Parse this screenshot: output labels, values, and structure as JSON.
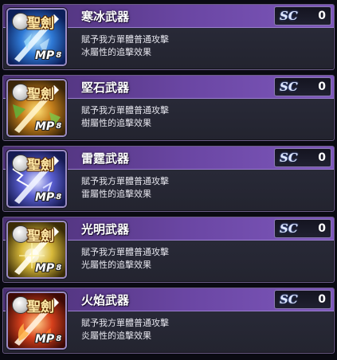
{
  "skills": [
    {
      "name": "寒冰武器",
      "sc_label": "SC",
      "sc_value": "0",
      "desc_line1": "賦予我方單體普通攻擊",
      "desc_line2": "冰屬性的追擊效果",
      "icon": {
        "label": "聖劍",
        "mp_label": "MP",
        "mp_value": "8",
        "element": "ice-sword-icon",
        "bg": "#1b4fb0",
        "glow": "#7ed0ff"
      }
    },
    {
      "name": "堅石武器",
      "sc_label": "SC",
      "sc_value": "0",
      "desc_line1": "賦予我方單體普通攻擊",
      "desc_line2": "樹屬性的追擊效果",
      "icon": {
        "label": "聖劍",
        "mp_label": "MP",
        "mp_value": "8",
        "element": "earth-sword-icon",
        "bg": "#6b4a12",
        "glow": "#f2b935"
      }
    },
    {
      "name": "雷霆武器",
      "sc_label": "SC",
      "sc_value": "0",
      "desc_line1": "賦予我方單體普通攻擊",
      "desc_line2": "雷屬性的追擊效果",
      "icon": {
        "label": "聖劍",
        "mp_label": "MP",
        "mp_value": "8",
        "element": "thunder-sword-icon",
        "bg": "#2a2f8a",
        "glow": "#c4c8ff"
      }
    },
    {
      "name": "光明武器",
      "sc_label": "SC",
      "sc_value": "0",
      "desc_line1": "賦予我方單體普通攻擊",
      "desc_line2": "光屬性的追擊效果",
      "icon": {
        "label": "聖劍",
        "mp_label": "MP",
        "mp_value": "8",
        "element": "light-sword-icon",
        "bg": "#5c4a10",
        "glow": "#fff2a0"
      }
    },
    {
      "name": "火焰武器",
      "sc_label": "SC",
      "sc_value": "0",
      "desc_line1": "賦予我方單體普通攻擊",
      "desc_line2": "炎屬性的追擊效果",
      "icon": {
        "label": "聖劍",
        "mp_label": "MP",
        "mp_value": "8",
        "element": "fire-sword-icon",
        "bg": "#7a1a0e",
        "glow": "#ff9a3a"
      }
    }
  ]
}
